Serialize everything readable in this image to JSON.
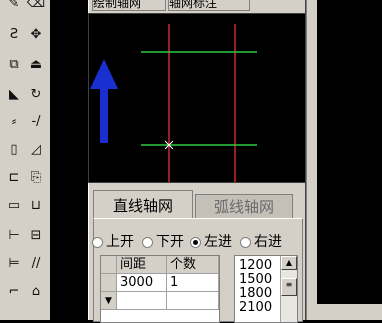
{
  "dialog": {
    "top_tabs": [
      "绘制轴网",
      "轴网标注"
    ],
    "tabs": [
      "直线轴网",
      "弧线轴网"
    ],
    "active_tab": "直线轴网",
    "radio_options": [
      {
        "label": "上开",
        "selected": false
      },
      {
        "label": "下开",
        "selected": false
      },
      {
        "label": "左进",
        "selected": true
      },
      {
        "label": "右进",
        "selected": false
      }
    ],
    "grid": {
      "columns": [
        "间距",
        "个数"
      ],
      "rows": [
        [
          "3000",
          "1"
        ],
        [
          "",
          ""
        ]
      ]
    },
    "value_list": [
      "1200",
      "1500",
      "1800",
      "2100"
    ]
  },
  "colors": {
    "preview_bg": "#000000",
    "axis_red": "#cc2a2a",
    "axis_green": "#2ecc40",
    "arrow_blue": "#1a2fd0",
    "dialog_bg": "#d4d0c8"
  },
  "toolbox": {
    "icons": [
      "pencil-icon",
      "eraser-icon",
      "curve-icon",
      "move-icon",
      "copy-icon",
      "stamp-icon",
      "mirror-icon",
      "rotate-icon",
      "trim-icon",
      "extend-icon",
      "rect-icon",
      "fillet-icon",
      "break-icon",
      "explode-icon",
      "box-icon",
      "box-open-icon",
      "dim-icon",
      "dim2-icon",
      "stretch-icon",
      "arc-icon",
      "hatch-icon",
      "text-icon"
    ]
  }
}
